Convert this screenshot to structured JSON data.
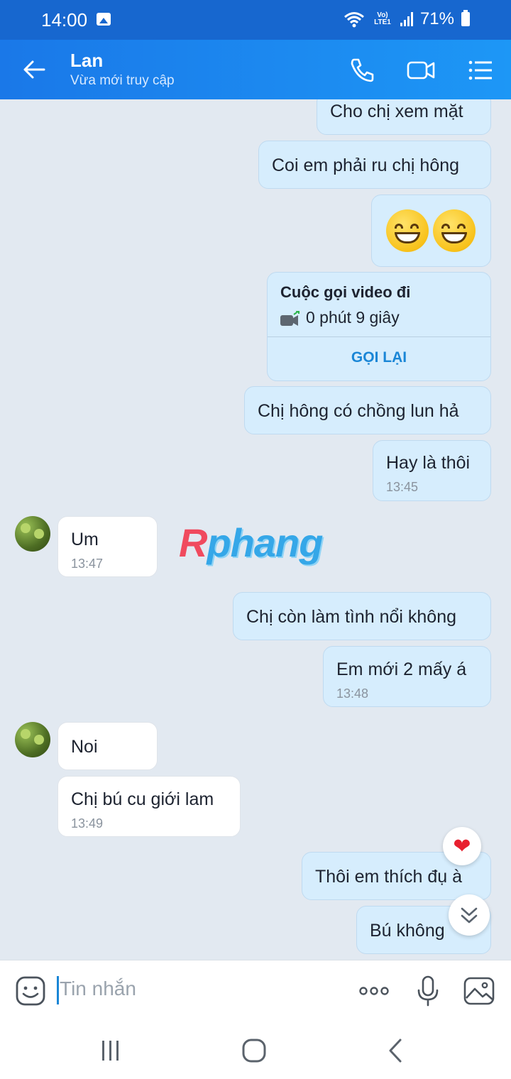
{
  "status_bar": {
    "time": "14:00",
    "network": "Vo) LTE1",
    "battery": "71%"
  },
  "header": {
    "contact_name": "Lan",
    "presence": "Vừa mới truy cập"
  },
  "messages": [
    {
      "dir": "out",
      "text": "Cho chị xem mặt"
    },
    {
      "dir": "out",
      "text": "Coi em phải ru chị hông"
    },
    {
      "dir": "out",
      "text": "😁😁"
    },
    {
      "dir": "out",
      "type": "call",
      "title": "Cuộc gọi video đi",
      "duration": "0 phút 9 giây",
      "action": "GỌI LẠI"
    },
    {
      "dir": "out",
      "text": "Chị hông có chồng lun hả"
    },
    {
      "dir": "out",
      "text": "Hay là thôi",
      "time": "13:45"
    },
    {
      "dir": "in",
      "text": "Um",
      "time": "13:47"
    },
    {
      "dir": "out",
      "text": "Chị còn làm tình nổi không"
    },
    {
      "dir": "out",
      "text": "Em mới 2 mấy á",
      "time": "13:48"
    },
    {
      "dir": "in",
      "text": "Noi"
    },
    {
      "dir": "in",
      "text": "Chị bú cu giới lam",
      "time": "13:49"
    },
    {
      "dir": "out",
      "text": "Thôi em thích đụ à"
    },
    {
      "dir": "out",
      "text": "Bú không"
    }
  ],
  "watermark": {
    "first": "R",
    "rest": "phang"
  },
  "input": {
    "placeholder": "Tin nhắn"
  },
  "colors": {
    "header": "#1a78e8",
    "outgoing_bubble": "#d6edfd",
    "incoming_bubble": "#ffffff",
    "chat_bg": "#e2e9f1",
    "accent": "#1a86d6"
  }
}
